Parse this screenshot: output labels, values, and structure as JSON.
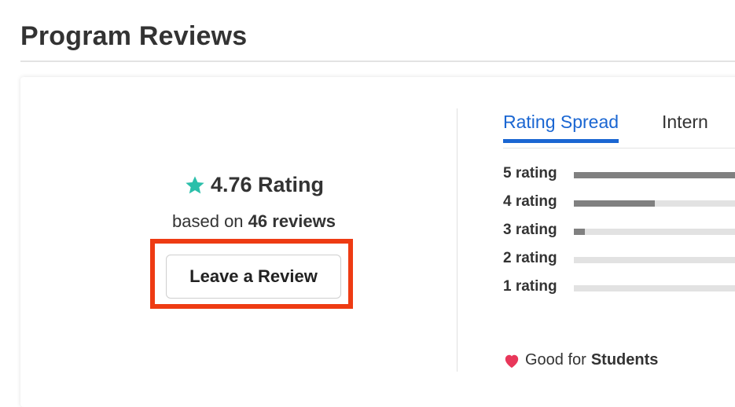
{
  "page": {
    "title": "Program Reviews"
  },
  "summary": {
    "rating_text": "4.76 Rating",
    "based_on_prefix": "based on",
    "reviews_count_text": "46 reviews",
    "leave_review_label": "Leave a Review",
    "star_icon": "star-icon",
    "star_color": "#2bbfaa",
    "highlight_color": "#ee3b13"
  },
  "tabs": [
    {
      "label": "Rating Spread",
      "active": true
    },
    {
      "label": "Intern",
      "active": false
    }
  ],
  "rating_spread": [
    {
      "label": "5 rating",
      "fraction": 0.98
    },
    {
      "label": "4 rating",
      "fraction": 0.43
    },
    {
      "label": "3 rating",
      "fraction": 0.06
    },
    {
      "label": "2 rating",
      "fraction": 0.0
    },
    {
      "label": "1 rating",
      "fraction": 0.0
    }
  ],
  "good_for": {
    "prefix": "Good for",
    "value": "Students",
    "icon": "heart-icon",
    "icon_color": "#e8375a"
  },
  "colors": {
    "accent": "#1a66d2",
    "bar_fill": "#808080",
    "bar_track": "#e2e2e2"
  }
}
